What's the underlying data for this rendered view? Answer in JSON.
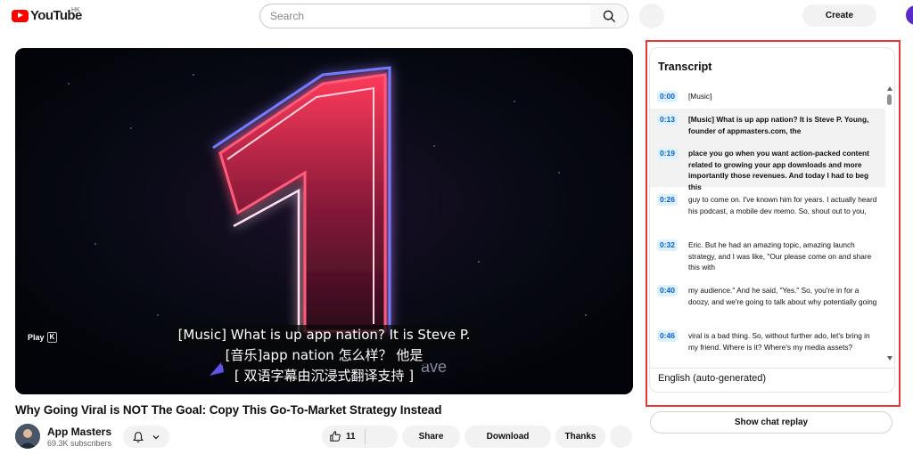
{
  "header": {
    "logo_text": "YouTube",
    "region": "HK",
    "search_placeholder": "Search",
    "create_label": "Create"
  },
  "player": {
    "play_label": "Play",
    "play_key": "K",
    "watermark": "ave",
    "captions": [
      "[Music] What is up app nation? It is Steve P.",
      "[音乐]app nation 怎么样？ 他是",
      "[ 双语字幕由沉浸式翻译支持 ]"
    ]
  },
  "video": {
    "title": "Why Going Viral is NOT The Goal: Copy This Go-To-Market Strategy Instead",
    "channel_name": "App Masters",
    "subscribers": "69.3K subscribers",
    "like_count": "11",
    "share_label": "Share",
    "download_label": "Download",
    "thanks_label": "Thanks"
  },
  "transcript": {
    "title": "Transcript",
    "language": "English (auto-generated)",
    "segments": [
      {
        "time": "0:00",
        "text": "[Music]",
        "active": false
      },
      {
        "time": "0:13",
        "text": "[Music] What is up app nation? It is Steve P. Young, founder of appmasters.com, the",
        "active": true
      },
      {
        "time": "0:19",
        "text": "place you go when you want action-packed content related to growing your app downloads and more importantly those revenues. And today I had to beg this",
        "active": true
      },
      {
        "time": "0:26",
        "text": "guy to come on. I've known him for years. I actually heard his podcast, a mobile dev memo. So, shout out to you,",
        "active": false
      },
      {
        "time": "0:32",
        "text": "Eric. But he had an amazing topic, amazing launch strategy, and I was like, \"Our please come on and share this with",
        "active": false
      },
      {
        "time": "0:40",
        "text": "my audience.\" And he said, \"Yes.\" So, you're in for a doozy, and we're going to talk about why potentially going",
        "active": false
      },
      {
        "time": "0:46",
        "text": "viral is a bad thing. So, without further ado, let's bring in my friend. Where is it? Where's my media assets?",
        "active": false
      }
    ]
  },
  "chat_replay_label": "Show chat replay",
  "colors": {
    "accent": "#065fd4",
    "brand_red": "#ff0000",
    "highlight_outline": "#e53935"
  }
}
